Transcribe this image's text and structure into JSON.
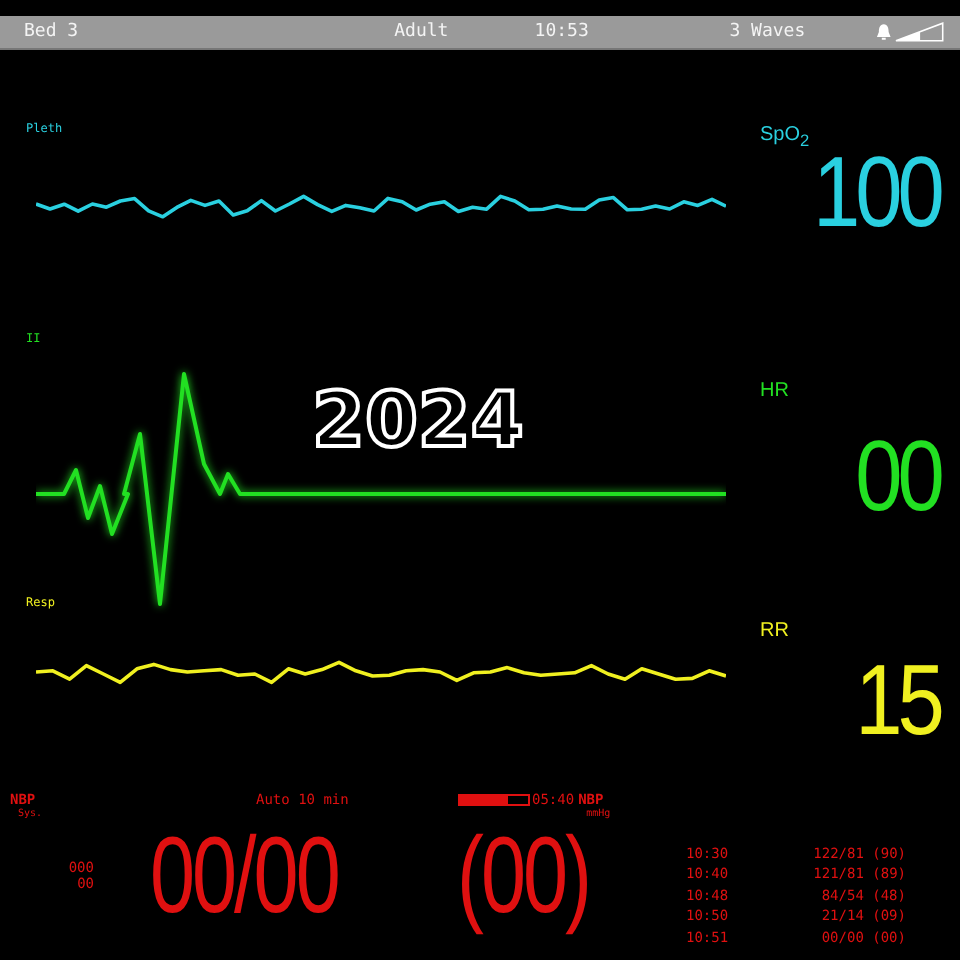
{
  "status_bar": {
    "bed": "Bed 3",
    "patient_type": "Adult",
    "time": "10:53",
    "layout": "3 Waves",
    "alarm_on": true
  },
  "waves": [
    {
      "kind": "pleth",
      "label": "Pleth",
      "color": "#2ad0e0",
      "vital": {
        "label": "SpO$_{2}$",
        "value": "100"
      }
    },
    {
      "kind": "ecg",
      "label": "II",
      "color": "#22e022",
      "overlay": "2024",
      "vital": {
        "label": "HR",
        "value": "00"
      }
    },
    {
      "kind": "resp",
      "label": "Resp",
      "color": "#f0f020",
      "vital": {
        "label": "RR",
        "value": "15"
      }
    }
  ],
  "nbp": {
    "label": "NBP",
    "unit": "Sys.",
    "mode": "Auto 10 min",
    "level": 0.7,
    "countdown": "05:40",
    "label_2": "NBP",
    "unit_2": "mmHg",
    "limits": [
      "000",
      "00"
    ],
    "reading": "00/00",
    "mean": "(00)",
    "history": [
      {
        "time": "10:30",
        "value": "122/81 (90)"
      },
      {
        "time": "10:40",
        "value": "121/81 (89)"
      },
      {
        "time": "10:48",
        "value": "84/54 (48)"
      },
      {
        "time": "10:50",
        "value": "21/14 (09)"
      },
      {
        "time": "10:51",
        "value": "00/00 (00)"
      }
    ]
  }
}
